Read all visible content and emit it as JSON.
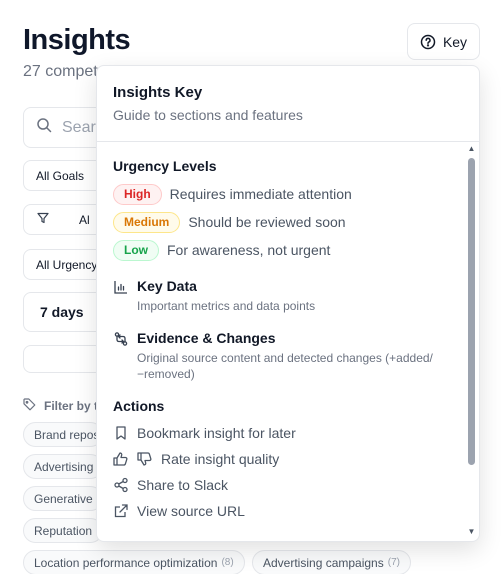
{
  "page": {
    "title": "Insights",
    "subtitle": "27 compet",
    "key_button_label": "Key"
  },
  "background_controls": {
    "search_placeholder": "Sear",
    "goals_select": "All Goals",
    "filter_label": "Al",
    "urgency_select": "All Urgency",
    "days_select": "7 days",
    "filter_tags_label": "Filter by t"
  },
  "tags": [
    {
      "label": "Brand repos",
      "count": ""
    },
    {
      "label": "Advertising",
      "count": ""
    },
    {
      "label": "Generative",
      "count": ""
    },
    {
      "label": "Reputation",
      "count": ""
    },
    {
      "label": "Location performance optimization",
      "count": "(8)"
    },
    {
      "label": "Advertising campaigns",
      "count": "(7)"
    }
  ],
  "popover": {
    "title": "Insights Key",
    "subtitle": "Guide to sections and features",
    "urgency_heading": "Urgency Levels",
    "urgency_levels": [
      {
        "badge": "High",
        "description": "Requires immediate attention",
        "color": "#dc2626",
        "bg": "#fef2f2",
        "border": "#fecaca"
      },
      {
        "badge": "Medium",
        "description": "Should be reviewed soon",
        "color": "#d97706",
        "bg": "#fffbeb",
        "border": "#fde68a"
      },
      {
        "badge": "Low",
        "description": "For awareness, not urgent",
        "color": "#16a34a",
        "bg": "#f0fdf4",
        "border": "#bbf7d0"
      }
    ],
    "features": [
      {
        "icon": "bar-chart-icon",
        "title": "Key Data",
        "description": "Important metrics and data points"
      },
      {
        "icon": "git-compare-icon",
        "title": "Evidence & Changes",
        "description": "Original source content and detected changes (+added/ −removed)"
      }
    ],
    "actions_heading": "Actions",
    "actions": [
      {
        "icon": "bookmark-icon",
        "label": "Bookmark insight for later"
      },
      {
        "icon": "thumbs-icon",
        "label": "Rate insight quality"
      },
      {
        "icon": "share-icon",
        "label": "Share to Slack"
      },
      {
        "icon": "external-link-icon",
        "label": "View source URL"
      }
    ]
  }
}
